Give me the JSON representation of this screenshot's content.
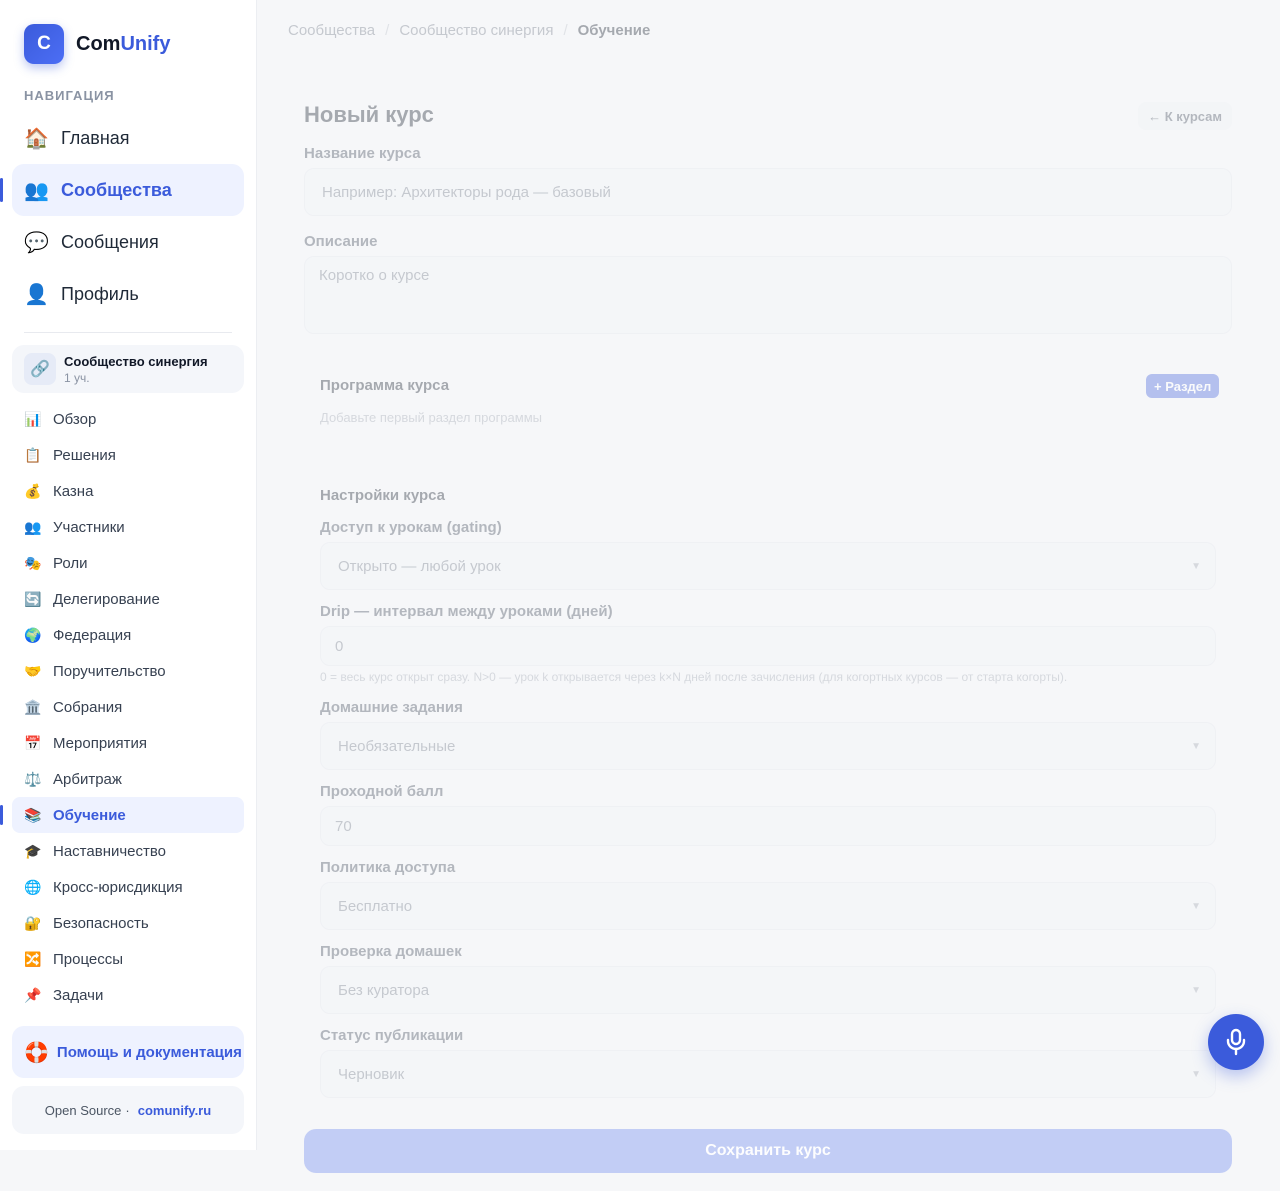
{
  "app": {
    "logo_letter": "C",
    "name_part1": "Com",
    "name_part2": "Unify"
  },
  "nav": {
    "title": "НАВИГАЦИЯ",
    "items": [
      {
        "icon": "🏠",
        "label": "Главная"
      },
      {
        "icon": "👥",
        "label": "Сообщества"
      },
      {
        "icon": "💬",
        "label": "Сообщения"
      },
      {
        "icon": "👤",
        "label": "Профиль"
      }
    ]
  },
  "community": {
    "icon": "🔗",
    "name": "Сообщество синергия",
    "members": "1 уч."
  },
  "sub_nav": [
    {
      "icon": "📊",
      "label": "Обзор"
    },
    {
      "icon": "📋",
      "label": "Решения"
    },
    {
      "icon": "💰",
      "label": "Казна"
    },
    {
      "icon": "👥",
      "label": "Участники"
    },
    {
      "icon": "🎭",
      "label": "Роли"
    },
    {
      "icon": "🔄",
      "label": "Делегирование"
    },
    {
      "icon": "🌍",
      "label": "Федерация"
    },
    {
      "icon": "🤝",
      "label": "Поручительство"
    },
    {
      "icon": "🏛️",
      "label": "Собрания"
    },
    {
      "icon": "📅",
      "label": "Мероприятия"
    },
    {
      "icon": "⚖️",
      "label": "Арбитраж"
    },
    {
      "icon": "📚",
      "label": "Обучение"
    },
    {
      "icon": "🎓",
      "label": "Наставничество"
    },
    {
      "icon": "🌐",
      "label": "Кросс-юрисдикция"
    },
    {
      "icon": "🔐",
      "label": "Безопасность"
    },
    {
      "icon": "🔀",
      "label": "Процессы"
    },
    {
      "icon": "📌",
      "label": "Задачи"
    }
  ],
  "help": {
    "icon": "🛟",
    "label": "Помощь и документация"
  },
  "footer": {
    "text": "Open Source",
    "sep": "·",
    "link": "comunify.ru"
  },
  "breadcrumb": {
    "item1": "Сообщества",
    "item2": "Сообщество синергия",
    "current": "Обучение",
    "sep": "/"
  },
  "form": {
    "title": "Новый курс",
    "back_label": "← К курсам",
    "name_label": "Название курса",
    "name_placeholder": "Например: Архитекторы рода — базовый",
    "desc_label": "Описание",
    "desc_placeholder": "Коротко о курсе",
    "program_title": "Программа курса",
    "add_section_label": "+ Раздел",
    "program_empty": "Добавьте первый раздел программы",
    "settings_title": "Настройки курса",
    "gating_label": "Доступ к урокам (gating)",
    "gating_value": "Открыто — любой урок",
    "drip_label": "Drip — интервал между уроками (дней)",
    "drip_value": "0",
    "drip_hint": "0 = весь курс открыт сразу. N>0 — урок k открывается через k×N дней после зачисления (для когортных курсов — от старта когорты).",
    "homework_label": "Домашние задания",
    "homework_value": "Необязательные",
    "pass_label": "Проходной балл",
    "pass_value": "70",
    "access_label": "Политика доступа",
    "access_value": "Бесплатно",
    "review_label": "Проверка домашек",
    "review_value": "Без куратора",
    "status_label": "Статус публикации",
    "status_value": "Черновик",
    "save_label": "Сохранить курс"
  },
  "colors": {
    "accent": "#3b5bdb",
    "active_bg": "#eef2ff"
  }
}
